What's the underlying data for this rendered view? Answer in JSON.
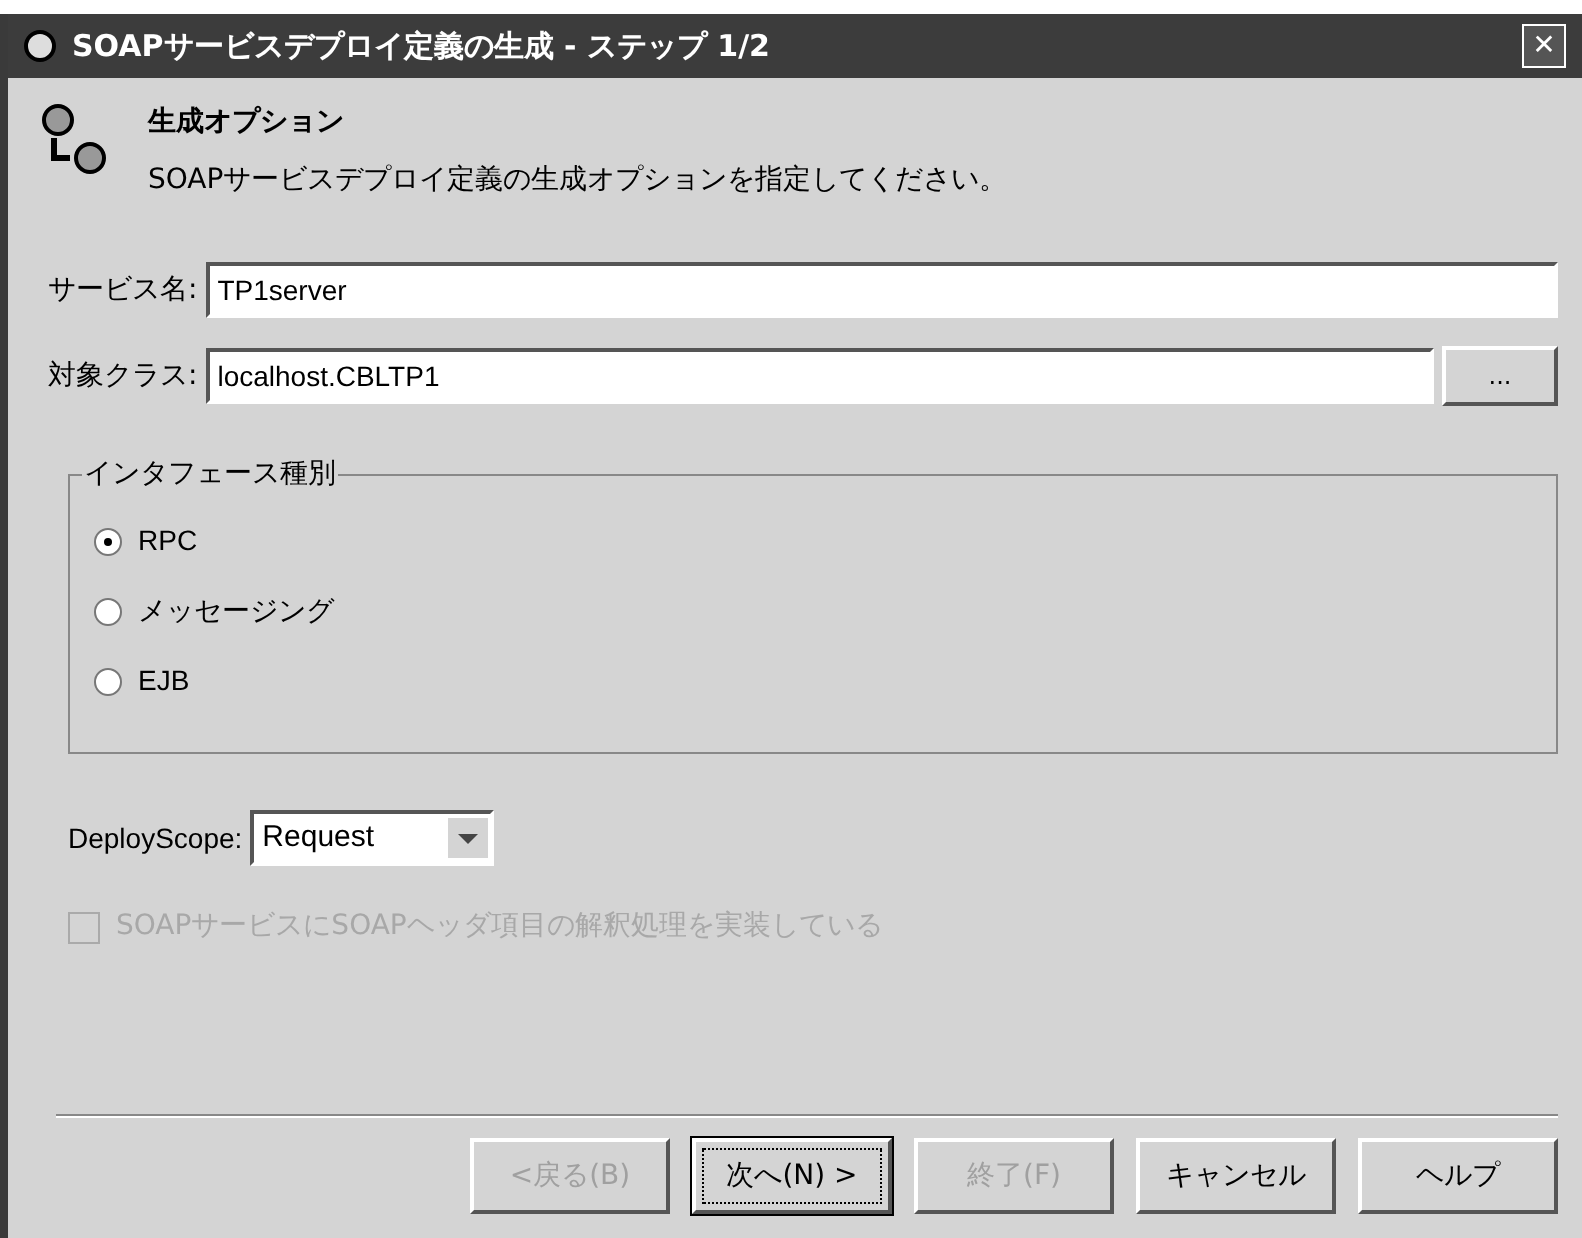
{
  "window": {
    "title": "SOAPサービスデプロイ定義の生成 - ステップ 1/2",
    "close": "✕"
  },
  "header": {
    "title": "生成オプション",
    "description": "SOAPサービスデプロイ定義の生成オプションを指定してください。"
  },
  "fields": [
    {
      "label": "サービス名:",
      "value": "TP1server"
    },
    {
      "label": "対象クラス:",
      "value": "localhost.CBLTP1",
      "browse": "..."
    }
  ],
  "interface_group": {
    "title": "インタフェース種別",
    "options": [
      {
        "label": "RPC",
        "selected": true
      },
      {
        "label": "メッセージング",
        "selected": false
      },
      {
        "label": "EJB",
        "selected": false
      }
    ]
  },
  "deploy_scope": {
    "label": "DeployScope:",
    "value": "Request"
  },
  "header_checkbox": {
    "label": "SOAPサービスにSOAPヘッダ項目の解釈処理を実装している",
    "checked": false,
    "disabled": true
  },
  "buttons": [
    {
      "label": "<戻る(B)",
      "disabled": true,
      "focused": false
    },
    {
      "label": "次へ(N) >",
      "disabled": false,
      "focused": true
    },
    {
      "label": "終了(F)",
      "disabled": true,
      "focused": false
    },
    {
      "label": "キャンセル",
      "disabled": false,
      "focused": false
    },
    {
      "label": "ヘルプ",
      "disabled": false,
      "focused": false
    }
  ]
}
